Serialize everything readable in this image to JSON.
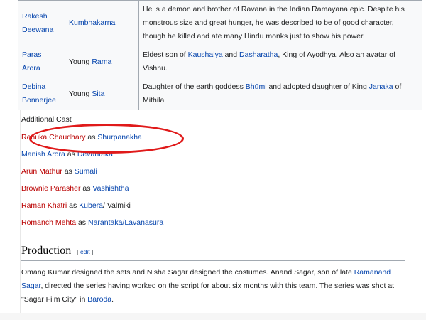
{
  "cast_table": {
    "rows": [
      {
        "actor_lines": [
          "Rakesh",
          "Deewana"
        ],
        "role_prefix": "",
        "role_link": "Kumbhakarna",
        "description": "He is a demon and brother of Ravana in the Indian Ramayana epic. Despite his monstrous size and great hunger, he was described to be of good character, though he killed and ate many Hindu monks just to show his power."
      },
      {
        "actor_lines": [
          "Paras Arora"
        ],
        "role_prefix": "Young ",
        "role_link": "Rama",
        "description_parts": [
          "Eldest son of ",
          "Kaushalya",
          " and ",
          "Dasharatha",
          ", King of Ayodhya. Also an avatar of Vishnu."
        ]
      },
      {
        "actor_lines": [
          "Debina",
          "Bonnerjee"
        ],
        "role_prefix": "Young ",
        "role_link": "Sita",
        "description_parts": [
          "Daughter of the earth goddess ",
          "Bhūmi",
          " and adopted daughter of King ",
          "Janaka",
          " of Mithila"
        ]
      }
    ]
  },
  "additional_cast": {
    "heading": "Additional Cast",
    "connector": " as ",
    "items": [
      {
        "actor": "Renuka Chaudhary",
        "role": "Shurpanakha",
        "extra": ""
      },
      {
        "actor": "Manish Arora",
        "role": "Devantaka",
        "extra": ""
      },
      {
        "actor": "Arun Mathur",
        "role": "Sumali",
        "extra": ""
      },
      {
        "actor": "Brownie Parasher",
        "role": "Vashishtha",
        "extra": ""
      },
      {
        "actor": "Raman Khatri",
        "role": "Kubera",
        "extra": "/ Valmiki"
      },
      {
        "actor": "Romanch Mehta",
        "role": "Narantaka/Lavanasura",
        "extra": ""
      }
    ]
  },
  "production": {
    "heading": "Production",
    "edit_open": "[ ",
    "edit_label": "edit",
    "edit_close": " ]",
    "text_parts": [
      "Omang Kumar designed the sets and Nisha Sagar designed the costumes. Anand Sagar, son of late ",
      "Ramanand Sagar",
      ", directed the series having worked on the script for about six months with this team. The series was shot at \"Sagar Film City\" in ",
      "Baroda",
      "."
    ]
  },
  "colors": {
    "link": "#0645ad",
    "redlink": "#ba0000",
    "annotation": "#e01a1a"
  }
}
